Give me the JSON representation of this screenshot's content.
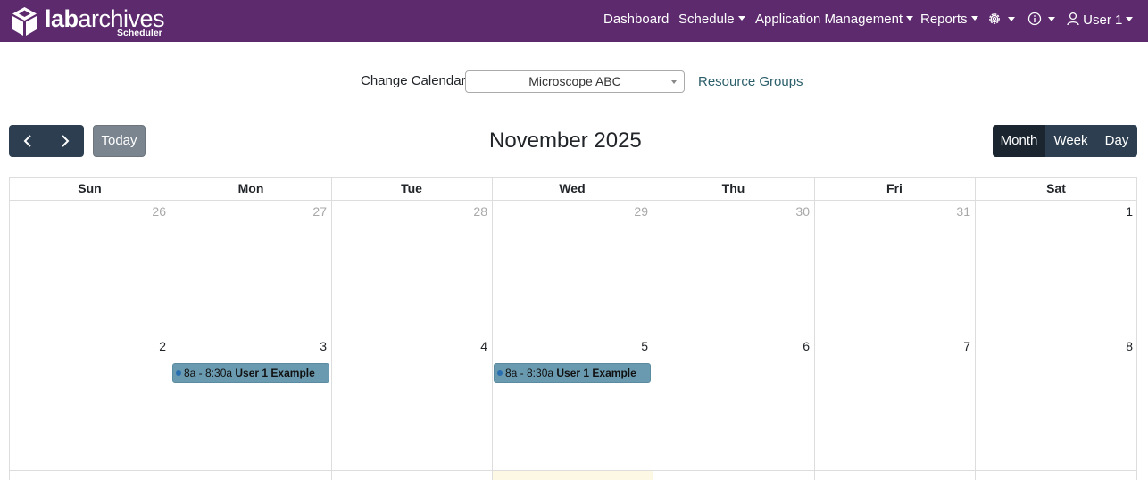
{
  "colors": {
    "brand": "#5d2a6e",
    "toolbar_button": "#2c3e50",
    "event_bg": "#6a9ab0",
    "today_bg": "#fcf8e3"
  },
  "brand": {
    "logo_icon": "labarchives-cube-icon",
    "name_bold": "lab",
    "name_rest": "archives",
    "sub": "Scheduler"
  },
  "nav": {
    "dashboard": "Dashboard",
    "schedule": "Schedule",
    "app_mgmt": "Application Management",
    "reports": "Reports",
    "settings_icon": "gear-icon",
    "info_icon": "info-icon",
    "user_icon": "user-icon",
    "user": "User 1"
  },
  "calendar_picker": {
    "label": "Change Calendar",
    "selected": "Microscope ABC",
    "resource_groups": "Resource Groups"
  },
  "toolbar": {
    "prev_icon": "chevron-left-icon",
    "next_icon": "chevron-right-icon",
    "today": "Today",
    "title": "November 2025",
    "views": {
      "month": "Month",
      "week": "Week",
      "day": "Day"
    },
    "active_view": "Month"
  },
  "calendar": {
    "weekdays": [
      "Sun",
      "Mon",
      "Tue",
      "Wed",
      "Thu",
      "Fri",
      "Sat"
    ],
    "weeks": [
      [
        "26",
        "27",
        "28",
        "29",
        "30",
        "31",
        "1"
      ],
      [
        "2",
        "3",
        "4",
        "5",
        "6",
        "7",
        "8"
      ]
    ],
    "events": {
      "mon3": {
        "time": "8a - 8:30a",
        "title": "User 1 Example"
      },
      "wed5": {
        "time": "8a - 8:30a",
        "title": "User 1 Example"
      }
    }
  }
}
